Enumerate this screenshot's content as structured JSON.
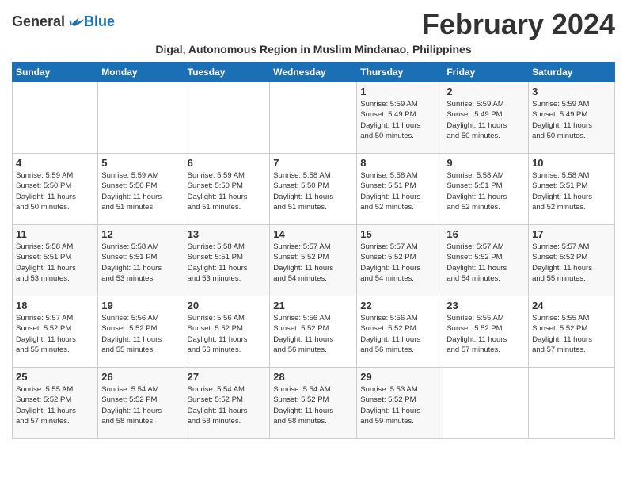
{
  "header": {
    "logo_general": "General",
    "logo_blue": "Blue",
    "month_title": "February 2024",
    "subtitle": "Digal, Autonomous Region in Muslim Mindanao, Philippines"
  },
  "columns": [
    "Sunday",
    "Monday",
    "Tuesday",
    "Wednesday",
    "Thursday",
    "Friday",
    "Saturday"
  ],
  "weeks": [
    [
      {
        "day": "",
        "info": ""
      },
      {
        "day": "",
        "info": ""
      },
      {
        "day": "",
        "info": ""
      },
      {
        "day": "",
        "info": ""
      },
      {
        "day": "1",
        "info": "Sunrise: 5:59 AM\nSunset: 5:49 PM\nDaylight: 11 hours\nand 50 minutes."
      },
      {
        "day": "2",
        "info": "Sunrise: 5:59 AM\nSunset: 5:49 PM\nDaylight: 11 hours\nand 50 minutes."
      },
      {
        "day": "3",
        "info": "Sunrise: 5:59 AM\nSunset: 5:49 PM\nDaylight: 11 hours\nand 50 minutes."
      }
    ],
    [
      {
        "day": "4",
        "info": "Sunrise: 5:59 AM\nSunset: 5:50 PM\nDaylight: 11 hours\nand 50 minutes."
      },
      {
        "day": "5",
        "info": "Sunrise: 5:59 AM\nSunset: 5:50 PM\nDaylight: 11 hours\nand 51 minutes."
      },
      {
        "day": "6",
        "info": "Sunrise: 5:59 AM\nSunset: 5:50 PM\nDaylight: 11 hours\nand 51 minutes."
      },
      {
        "day": "7",
        "info": "Sunrise: 5:58 AM\nSunset: 5:50 PM\nDaylight: 11 hours\nand 51 minutes."
      },
      {
        "day": "8",
        "info": "Sunrise: 5:58 AM\nSunset: 5:51 PM\nDaylight: 11 hours\nand 52 minutes."
      },
      {
        "day": "9",
        "info": "Sunrise: 5:58 AM\nSunset: 5:51 PM\nDaylight: 11 hours\nand 52 minutes."
      },
      {
        "day": "10",
        "info": "Sunrise: 5:58 AM\nSunset: 5:51 PM\nDaylight: 11 hours\nand 52 minutes."
      }
    ],
    [
      {
        "day": "11",
        "info": "Sunrise: 5:58 AM\nSunset: 5:51 PM\nDaylight: 11 hours\nand 53 minutes."
      },
      {
        "day": "12",
        "info": "Sunrise: 5:58 AM\nSunset: 5:51 PM\nDaylight: 11 hours\nand 53 minutes."
      },
      {
        "day": "13",
        "info": "Sunrise: 5:58 AM\nSunset: 5:51 PM\nDaylight: 11 hours\nand 53 minutes."
      },
      {
        "day": "14",
        "info": "Sunrise: 5:57 AM\nSunset: 5:52 PM\nDaylight: 11 hours\nand 54 minutes."
      },
      {
        "day": "15",
        "info": "Sunrise: 5:57 AM\nSunset: 5:52 PM\nDaylight: 11 hours\nand 54 minutes."
      },
      {
        "day": "16",
        "info": "Sunrise: 5:57 AM\nSunset: 5:52 PM\nDaylight: 11 hours\nand 54 minutes."
      },
      {
        "day": "17",
        "info": "Sunrise: 5:57 AM\nSunset: 5:52 PM\nDaylight: 11 hours\nand 55 minutes."
      }
    ],
    [
      {
        "day": "18",
        "info": "Sunrise: 5:57 AM\nSunset: 5:52 PM\nDaylight: 11 hours\nand 55 minutes."
      },
      {
        "day": "19",
        "info": "Sunrise: 5:56 AM\nSunset: 5:52 PM\nDaylight: 11 hours\nand 55 minutes."
      },
      {
        "day": "20",
        "info": "Sunrise: 5:56 AM\nSunset: 5:52 PM\nDaylight: 11 hours\nand 56 minutes."
      },
      {
        "day": "21",
        "info": "Sunrise: 5:56 AM\nSunset: 5:52 PM\nDaylight: 11 hours\nand 56 minutes."
      },
      {
        "day": "22",
        "info": "Sunrise: 5:56 AM\nSunset: 5:52 PM\nDaylight: 11 hours\nand 56 minutes."
      },
      {
        "day": "23",
        "info": "Sunrise: 5:55 AM\nSunset: 5:52 PM\nDaylight: 11 hours\nand 57 minutes."
      },
      {
        "day": "24",
        "info": "Sunrise: 5:55 AM\nSunset: 5:52 PM\nDaylight: 11 hours\nand 57 minutes."
      }
    ],
    [
      {
        "day": "25",
        "info": "Sunrise: 5:55 AM\nSunset: 5:52 PM\nDaylight: 11 hours\nand 57 minutes."
      },
      {
        "day": "26",
        "info": "Sunrise: 5:54 AM\nSunset: 5:52 PM\nDaylight: 11 hours\nand 58 minutes."
      },
      {
        "day": "27",
        "info": "Sunrise: 5:54 AM\nSunset: 5:52 PM\nDaylight: 11 hours\nand 58 minutes."
      },
      {
        "day": "28",
        "info": "Sunrise: 5:54 AM\nSunset: 5:52 PM\nDaylight: 11 hours\nand 58 minutes."
      },
      {
        "day": "29",
        "info": "Sunrise: 5:53 AM\nSunset: 5:52 PM\nDaylight: 11 hours\nand 59 minutes."
      },
      {
        "day": "",
        "info": ""
      },
      {
        "day": "",
        "info": ""
      }
    ]
  ]
}
